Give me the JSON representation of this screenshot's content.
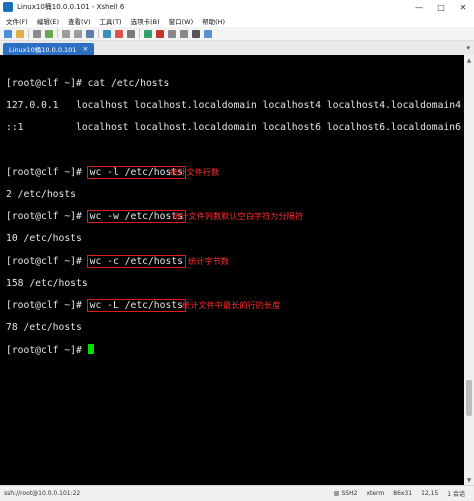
{
  "window": {
    "title": "Linux10桶10.0.0.101 - Xshell 6"
  },
  "menu": [
    "文件(F)",
    "编辑(E)",
    "查看(V)",
    "工具(T)",
    "选项卡(B)",
    "窗口(W)",
    "帮助(H)"
  ],
  "tab": {
    "label": "Linux10桶10.0.0.101"
  },
  "terminal": {
    "lines": [
      "[root@clf ~]# cat /etc/hosts",
      "127.0.0.1   localhost localhost.localdomain localhost4 localhost4.localdomain4",
      "::1         localhost localhost.localdomain localhost6 localhost6.localdomain6",
      "",
      "[root@clf ~]# wc -l /etc/hosts",
      "2 /etc/hosts",
      "[root@clf ~]# wc -w /etc/hosts",
      "10 /etc/hosts",
      "[root@clf ~]# wc -c /etc/hosts",
      "158 /etc/hosts",
      "[root@clf ~]# wc -L /etc/hosts",
      "78 /etc/hosts",
      "[root@clf ~]# "
    ],
    "prompt": "[root@clf ~]# ",
    "commands": [
      {
        "cmd": "wc -l /etc/hosts",
        "note": "统计文件行数"
      },
      {
        "cmd": "wc -w /etc/hosts",
        "note": "统计文件列数默认空白字符为分隔符"
      },
      {
        "cmd": "wc -c /etc/hosts",
        "note": "统计字节数"
      },
      {
        "cmd": "wc -L /etc/hosts",
        "note": "统计文件中最长的行的长度"
      }
    ],
    "outputs": [
      "2 /etc/hosts",
      "10 /etc/hosts",
      "158 /etc/hosts",
      "78 /etc/hosts"
    ],
    "cat_cmd": "cat /etc/hosts",
    "hosts_line1": "127.0.0.1   localhost localhost.localdomain localhost4 localhost4.localdomain4",
    "hosts_line2": "::1         localhost localhost.localdomain localhost6 localhost6.localdomain6"
  },
  "status": {
    "connection": "ssh://root@10.0.0.101:22",
    "protocol": "SSH2",
    "term": "xterm",
    "size": "86x31",
    "cursor": "12,15",
    "sessions": "1 会话"
  },
  "colors": {
    "terminal_bg": "#000000",
    "terminal_fg": "#e6e6e6",
    "annotation": "#ff2a2a",
    "cursor": "#00e000",
    "tab_active": "#2b6fc4"
  }
}
